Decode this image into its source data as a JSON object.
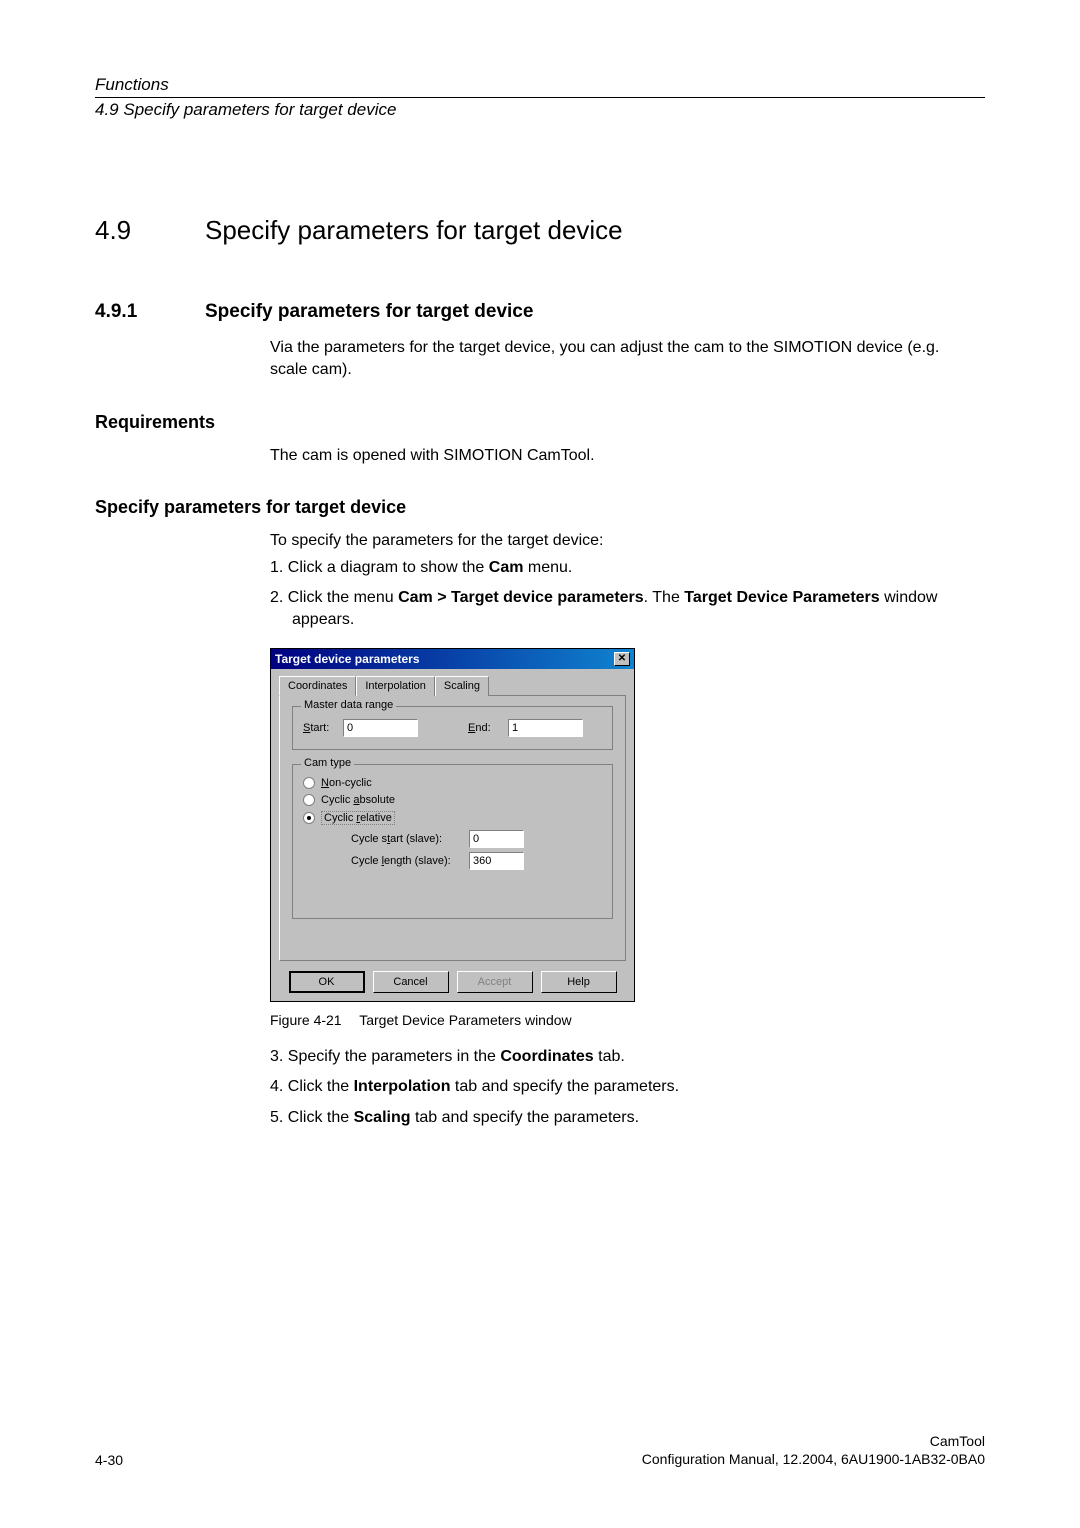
{
  "header": {
    "functions": "Functions",
    "sub": "4.9 Specify parameters for target device"
  },
  "h1": {
    "num": "4.9",
    "text": "Specify parameters for target device"
  },
  "h2": {
    "num": "4.9.1",
    "text": "Specify parameters for target device"
  },
  "intro": "Via the parameters for the target device, you can adjust the cam to the SIMOTION device (e.g. scale cam).",
  "requirements": {
    "label": "Requirements",
    "text": "The cam is opened with SIMOTION CamTool."
  },
  "specify": {
    "label": "Specify parameters for target device",
    "intro": "To specify the parameters for the target device:",
    "steps": {
      "s1_pre": "1.  Click a diagram to show the ",
      "s1_bold": "Cam",
      "s1_post": " menu.",
      "s2_pre": "2.  Click the menu ",
      "s2_bold1": "Cam > Target device parameters",
      "s2_mid": ". The ",
      "s2_bold2": "Target Device Parameters",
      "s2_post": " window appears.",
      "s3_pre": "3.  Specify the parameters in the ",
      "s3_bold": "Coordinates",
      "s3_post": " tab.",
      "s4_pre": "4.  Click the ",
      "s4_bold": "Interpolation",
      "s4_post": " tab and specify the parameters.",
      "s5_pre": "5.  Click the ",
      "s5_bold": "Scaling",
      "s5_post": " tab and specify the parameters."
    }
  },
  "dialog": {
    "title": "Target device parameters",
    "tabs": {
      "coordinates": "Coordinates",
      "interpolation": "Interpolation",
      "scaling": "Scaling"
    },
    "group_master": "Master data range",
    "start_label_u": "S",
    "start_label_rest": "tart:",
    "start_value": "0",
    "end_label_u": "E",
    "end_label_rest": "nd:",
    "end_value": "1",
    "group_cam": "Cam type",
    "radio_non_u": "N",
    "radio_non_rest": "on-cyclic",
    "radio_abs_pre": "Cyclic ",
    "radio_abs_u": "a",
    "radio_abs_post": "bsolute",
    "radio_rel_pre": "Cyclic ",
    "radio_rel_u": "r",
    "radio_rel_post": "elative",
    "cycle_start_pre": "Cycle s",
    "cycle_start_u": "t",
    "cycle_start_post": "art (slave):",
    "cycle_start_value": "0",
    "cycle_length_pre": "Cycle ",
    "cycle_length_u": "l",
    "cycle_length_post": "ength (slave):",
    "cycle_length_value": "360",
    "ok": "OK",
    "cancel": "Cancel",
    "accept": "Accept",
    "help": "Help"
  },
  "figure": {
    "label": "Figure 4-21",
    "caption": "Target Device Parameters window"
  },
  "footer": {
    "page": "4-30",
    "right1": "CamTool",
    "right2": "Configuration Manual, 12.2004, 6AU1900-1AB32-0BA0"
  }
}
